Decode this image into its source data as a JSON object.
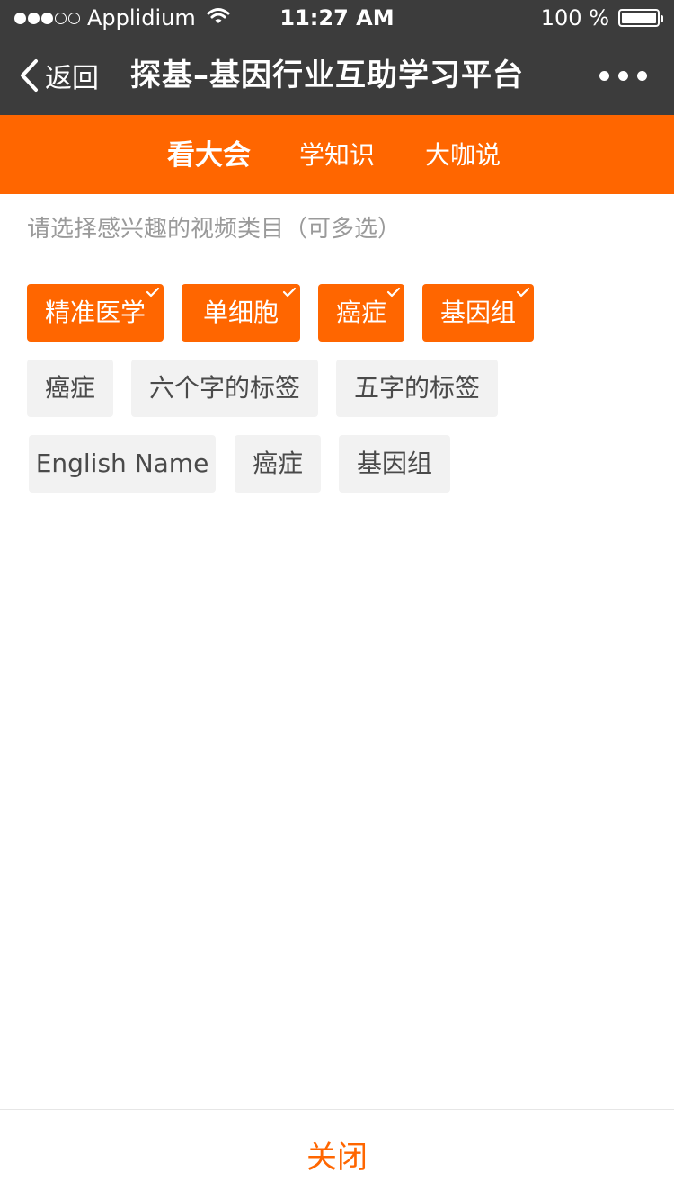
{
  "status_bar": {
    "carrier": "Applidium",
    "signal_full_dots": 3,
    "signal_empty_dots": 2,
    "time": "11:27 AM",
    "battery_text": "100 %",
    "battery_level": 1.0
  },
  "nav": {
    "back_label": "返回",
    "title": "探基–基因行业互助学习平台"
  },
  "tabs": [
    {
      "label": "看大会",
      "active": true
    },
    {
      "label": "学知识",
      "active": false
    },
    {
      "label": "大咖说",
      "active": false
    }
  ],
  "prompt": "请选择感兴趣的视频类目（可多选）",
  "tags": [
    {
      "label": "精准医学",
      "selected": true
    },
    {
      "label": "单细胞",
      "selected": true
    },
    {
      "label": "癌症",
      "selected": true
    },
    {
      "label": "基因组",
      "selected": true
    },
    {
      "label": "癌症",
      "selected": false
    },
    {
      "label": "六个字的标签",
      "selected": false
    },
    {
      "label": "五字的标签",
      "selected": false
    },
    {
      "label": "English Name",
      "selected": false
    },
    {
      "label": "癌症",
      "selected": false
    },
    {
      "label": "基因组",
      "selected": false
    }
  ],
  "footer": {
    "close_label": "关闭"
  },
  "colors": {
    "accent": "#ff6600",
    "bar": "#3c3c3c",
    "tag_bg": "#f2f2f2"
  }
}
